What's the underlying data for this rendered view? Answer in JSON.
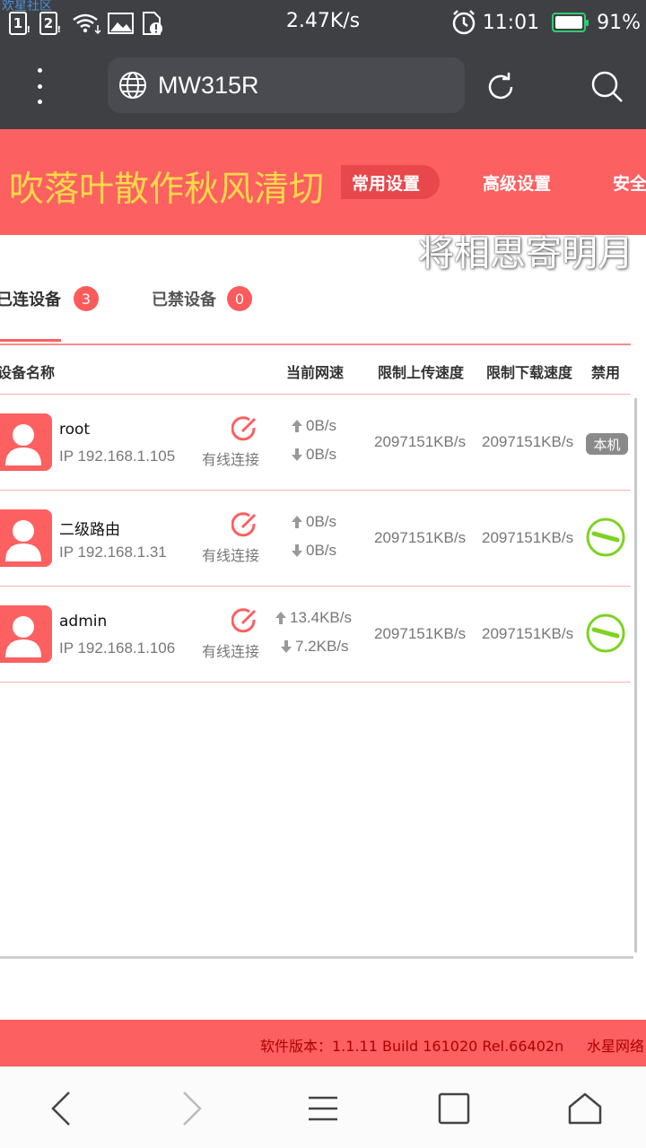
{
  "status_bar": {
    "watermark": "欢星社区",
    "sim1": "1",
    "sim2": "2",
    "network_speed": "2.47K/s",
    "time": "11:01",
    "battery": "91%"
  },
  "browser": {
    "url": "MW315R"
  },
  "header": {
    "poem_line1": "吹落叶散作秋风清切",
    "nav_items": [
      "常用设置",
      "高级设置",
      "安全"
    ],
    "poem_line2": "将相思寄明月"
  },
  "tabs": [
    {
      "label": "已连设备",
      "count": "3"
    },
    {
      "label": "已禁设备",
      "count": "0"
    }
  ],
  "table": {
    "headers": [
      "设备名称",
      "当前网速",
      "限制上传速度",
      "限制下载速度",
      "禁用"
    ],
    "rows": [
      {
        "name": "root",
        "ip": "IP 192.168.1.105",
        "connection": "有线连接",
        "up": "0B/s",
        "down": "0B/s",
        "limit_up": "2097151KB/s",
        "limit_down": "2097151KB/s",
        "action": "本机"
      },
      {
        "name": "二级路由",
        "ip": "IP 192.168.1.31",
        "connection": "有线连接",
        "up": "0B/s",
        "down": "0B/s",
        "limit_up": "2097151KB/s",
        "limit_down": "2097151KB/s",
        "action": ""
      },
      {
        "name": "admin",
        "ip": "IP 192.168.1.106",
        "connection": "有线连接",
        "up": "13.4KB/s",
        "down": "7.2KB/s",
        "limit_up": "2097151KB/s",
        "limit_down": "2097151KB/s",
        "action": ""
      }
    ]
  },
  "footer": {
    "version": "软件版本：1.1.11 Build 161020 Rel.66402n",
    "brand": "水星网络"
  },
  "colors": {
    "accent": "#fc6061",
    "status_bar": "#3f4044",
    "ban_green": "#7ed321"
  }
}
